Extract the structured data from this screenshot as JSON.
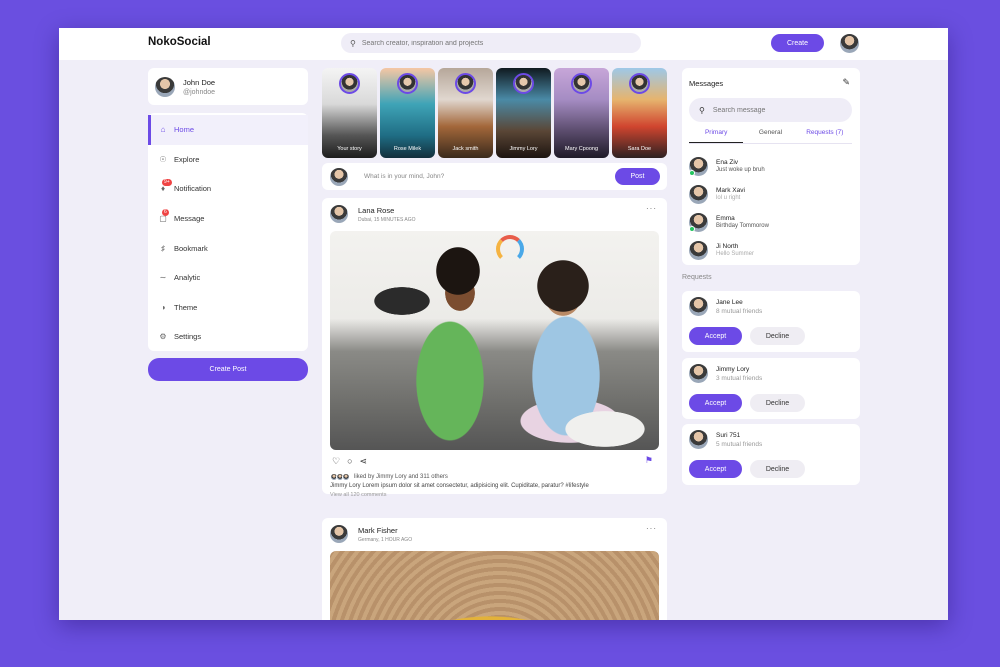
{
  "header": {
    "logo": "NokoSocial",
    "search_placeholder": "Search creator, inspiration and projects",
    "create_label": "Create"
  },
  "profile": {
    "name": "John Doe",
    "handle": "@johndoe"
  },
  "menu": {
    "items": [
      {
        "label": "Home",
        "icon": "home-icon"
      },
      {
        "label": "Explore",
        "icon": "compass-icon"
      },
      {
        "label": "Notification",
        "icon": "bell-icon",
        "badge": "9+"
      },
      {
        "label": "Message",
        "icon": "chat-icon",
        "badge": "6"
      },
      {
        "label": "Bookmark",
        "icon": "bookmark-icon"
      },
      {
        "label": "Analytic",
        "icon": "chart-icon"
      },
      {
        "label": "Theme",
        "icon": "palette-icon"
      },
      {
        "label": "Settings",
        "icon": "gear-icon"
      }
    ],
    "create_post_label": "Create Post"
  },
  "stories": [
    {
      "label": "Your story"
    },
    {
      "label": "Rose Milek"
    },
    {
      "label": "Jack smith"
    },
    {
      "label": "Jimmy Lory"
    },
    {
      "label": "Mary Cpoong"
    },
    {
      "label": "Sara Doe"
    }
  ],
  "compose": {
    "placeholder": "What is in your mind, John?",
    "post_label": "Post"
  },
  "feed": [
    {
      "author": "Lana Rose",
      "meta": "Dubai, 15 MINUTES AGO",
      "liked_by": "liked by Jimmy Lory and 311 others",
      "caption": "Jimmy Lory Lorem ipsum dolor sit amet consectetur, adipisicing elit. Cupiditate, paratur? #lifestyle",
      "view_all": "View all 120 comments"
    },
    {
      "author": "Mark Fisher",
      "meta": "Germany, 1 HOUR AGO"
    }
  ],
  "messages": {
    "title": "Messages",
    "search_placeholder": "Search message",
    "tabs": [
      "Primary",
      "General",
      "Requests (7)"
    ],
    "items": [
      {
        "name": "Ena Ziv",
        "text": "Just woke up bruh",
        "online": true
      },
      {
        "name": "Mark Xavi",
        "text": "lol u right",
        "online": false
      },
      {
        "name": "Emma",
        "text": "Birthday Tommorow",
        "online": true
      },
      {
        "name": "Ji North",
        "text": "Hello Summer",
        "online": false
      }
    ]
  },
  "requests": {
    "title": "Requests",
    "accept_label": "Accept",
    "decline_label": "Decline",
    "items": [
      {
        "name": "Jane Lee",
        "mutual": "8 mutual friends"
      },
      {
        "name": "Jimmy Lory",
        "mutual": "3 mutual friends"
      },
      {
        "name": "Suri 751",
        "mutual": "5 mutual friends"
      }
    ]
  },
  "colors": {
    "accent": "#6c4ae6",
    "background": "#6a4fe0",
    "panel": "#f0eef8"
  }
}
